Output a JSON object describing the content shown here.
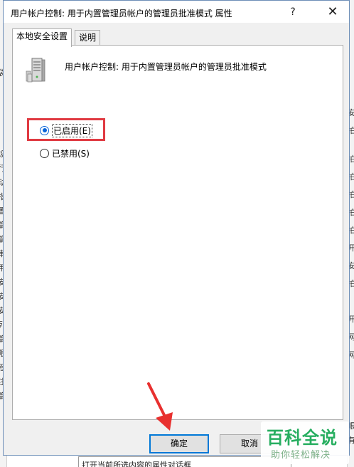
{
  "background": {
    "left_fragments": [
      "袋",
      "设",
      "行",
      "动",
      "指",
      "置",
      "篇",
      "篇",
      "审",
      "用",
      "安",
      "安",
      "安",
      "列",
      "篇",
      "限",
      "程",
      "注",
      "篇"
    ],
    "right_fragments": [
      "安",
      "拍",
      "拍",
      "拍",
      "拍",
      "拍",
      "拍",
      "开",
      "安",
      "拍",
      "开",
      "网",
      "网",
      "眼",
      "有"
    ],
    "bottom_hint": "打开当前所选内容的属性对话框"
  },
  "dialog": {
    "title": "用户帐户控制: 用于内置管理员帐户的管理员批准模式 属性",
    "help_glyph": "?",
    "close_glyph": "✕",
    "tabs": [
      {
        "label": "本地安全设置",
        "active": true
      },
      {
        "label": "说明",
        "active": false
      }
    ],
    "policy_icon": "server-policy-icon",
    "policy_name": "用户帐户控制: 用于内置管理员帐户的管理员批准模式",
    "options": [
      {
        "label": "已启用(E)",
        "checked": true
      },
      {
        "label": "已禁用(S)",
        "checked": false
      }
    ],
    "buttons": {
      "ok": "确定",
      "cancel": "取消"
    }
  },
  "annotation": {
    "highlight_color": "#e03a42",
    "arrow_color": "#e8302f"
  },
  "watermark": {
    "title": "百科全说",
    "subtitle": "助你轻松解决",
    "color": "#27ae60"
  }
}
